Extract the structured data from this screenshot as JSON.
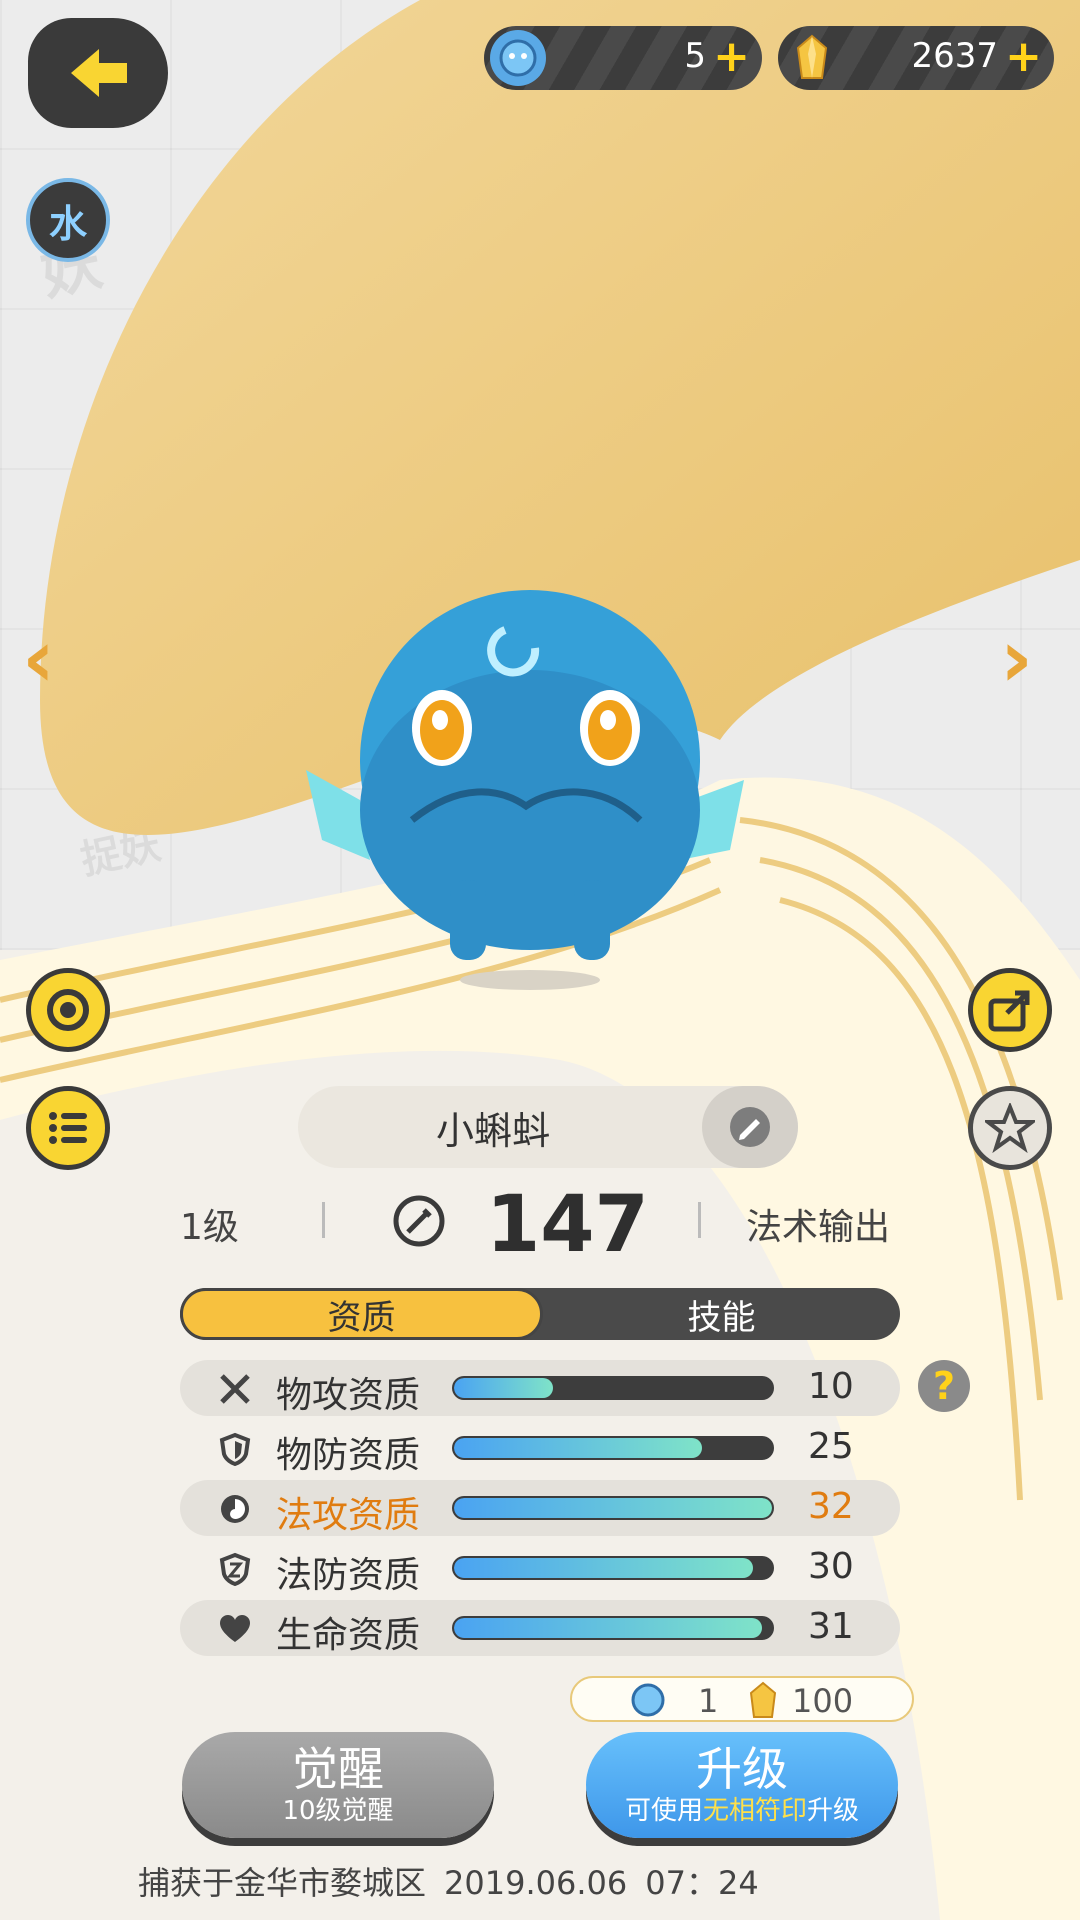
{
  "header": {
    "currency_orb": {
      "value": "5",
      "icon": "blue-orb-icon"
    },
    "currency_crystal": {
      "value": "2637",
      "icon": "gold-crystal-icon"
    }
  },
  "element_badge": "水",
  "pet": {
    "name": "小蝌蚪",
    "level": "1级",
    "power": "147",
    "role": "法术输出"
  },
  "tabs": [
    {
      "label": "资质",
      "active": true
    },
    {
      "label": "技能",
      "active": false
    }
  ],
  "attributes": [
    {
      "label": "物攻资质",
      "value": "10",
      "fill": 0.31,
      "icon": "crossed-swords-icon",
      "highlight": false,
      "shaded": true
    },
    {
      "label": "物防资质",
      "value": "25",
      "fill": 0.78,
      "icon": "shield-icon",
      "highlight": false,
      "shaded": false
    },
    {
      "label": "法攻资质",
      "value": "32",
      "fill": 1.0,
      "icon": "magic-swirl-icon",
      "highlight": true,
      "shaded": true
    },
    {
      "label": "法防资质",
      "value": "30",
      "fill": 0.94,
      "icon": "magic-shield-icon",
      "highlight": false,
      "shaded": false
    },
    {
      "label": "生命资质",
      "value": "31",
      "fill": 0.97,
      "icon": "heart-icon",
      "highlight": false,
      "shaded": true
    }
  ],
  "cost": {
    "orb": "1",
    "crystal": "100"
  },
  "buttons": {
    "awaken": {
      "label": "觉醒",
      "sub": "10级觉醒"
    },
    "upgrade": {
      "label": "升级",
      "sub_prefix": "可使用",
      "sub_highlight": "无相符印",
      "sub_suffix": "升级"
    }
  },
  "footer": {
    "capture_place": "捕获于金华市婺城区",
    "date": "2019.06.06",
    "time": "07：24"
  },
  "colors": {
    "accent_yellow": "#f9d532",
    "highlight_orange": "#e07c10",
    "bar_start": "#4aa3f2",
    "bar_end": "#7fe3c8",
    "upgrade_blue": "#3e97ea"
  }
}
